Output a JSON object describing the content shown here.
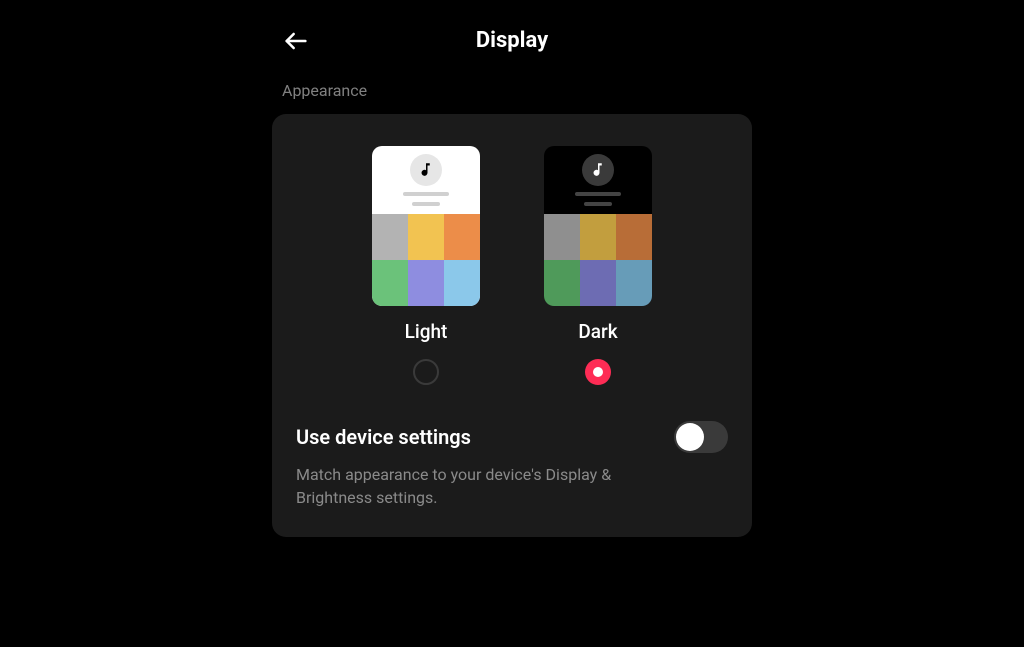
{
  "header": {
    "title": "Display"
  },
  "section_label": "Appearance",
  "themes": {
    "light": {
      "label": "Light",
      "selected": false,
      "tiles": [
        "#b3b3b3",
        "#f2c351",
        "#ec8d49",
        "#6bc27a",
        "#8e8de0",
        "#8bc8ea"
      ]
    },
    "dark": {
      "label": "Dark",
      "selected": true,
      "tiles": [
        "#8f8f8f",
        "#c29e3e",
        "#b86d37",
        "#4f9a5a",
        "#6d6cb3",
        "#679cb8"
      ]
    }
  },
  "device_settings": {
    "title": "Use device settings",
    "description": "Match appearance to your device's Display & Brightness settings.",
    "enabled": false
  },
  "colors": {
    "accent": "#fe2c55",
    "card_bg": "#1b1b1b",
    "muted_text": "#8a8a8a"
  },
  "icons": {
    "back": "arrow-left",
    "app_logo": "music-note"
  }
}
